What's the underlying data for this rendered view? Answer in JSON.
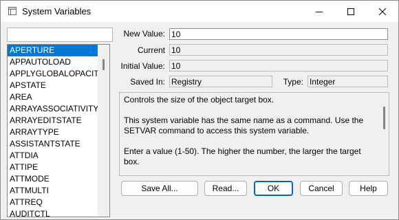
{
  "window": {
    "title": "System Variables"
  },
  "search": {
    "value": ""
  },
  "variables": [
    "APERTURE",
    "APPAUTOLOAD",
    "APPLYGLOBALOPACIT",
    "APSTATE",
    "AREA",
    "ARRAYASSOCIATIVITY",
    "ARRAYEDITSTATE",
    "ARRAYTYPE",
    "ASSISTANTSTATE",
    "ATTDIA",
    "ATTIPE",
    "ATTMODE",
    "ATTMULTI",
    "ATTREQ",
    "AUDITCTL"
  ],
  "selected_variable": "APERTURE",
  "fields": {
    "new_value_label": "New Value:",
    "new_value": "10",
    "current_label": "Current",
    "current": "10",
    "initial_label": "Initial Value:",
    "initial": "10",
    "saved_in_label": "Saved In:",
    "saved_in": "Registry",
    "type_label": "Type:",
    "type": "Integer"
  },
  "description": [
    "Controls the size of the object target box.",
    "This system variable has the same name as a command. Use the SETVAR command to access this system variable.",
    "Enter a value (1-50). The higher the number, the larger the target box."
  ],
  "buttons": {
    "save_all": "Save All...",
    "read": "Read...",
    "ok": "OK",
    "cancel": "Cancel",
    "help": "Help"
  }
}
